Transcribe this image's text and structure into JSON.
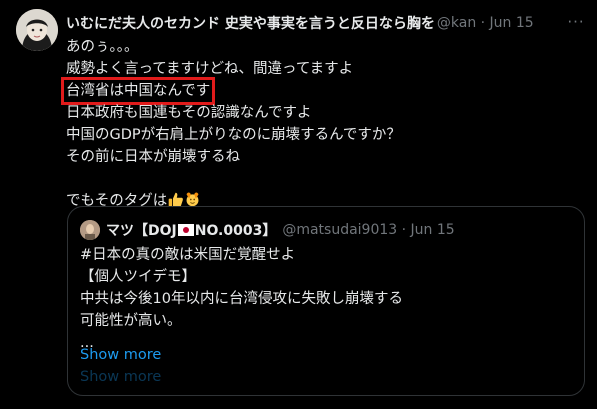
{
  "tweet": {
    "author_name": "いむにだ夫人のセカンド 史実や事実を言うと反日なら胸を",
    "handle_meta": "@kan · Jun 15",
    "more_label": "···",
    "lines": [
      "あのぅ。。。",
      "威勢よく言ってますけどね、間違ってますよ",
      "台湾省は中国なんです",
      "日本政府も国連もその認識なんですよ",
      "中国のGDPが右肩上がりなのに崩壊するんですか？",
      "その前に日本が崩壊するね",
      "",
      "でもそのタグは"
    ],
    "highlight_line_index": 2,
    "emoji_icons": [
      "thumbs-up-icon",
      "raising-hands-face-icon"
    ]
  },
  "quote": {
    "name_prefix": "マツ【DOJ",
    "name_suffix": "NO.0003】",
    "flag_icon": "japan-flag-icon",
    "handle_meta": "@matsudai9013 · Jun 15",
    "lines": [
      "#日本の真の敵は米国だ覚醒せよ",
      "【個人ツイデモ】",
      "中共は今後10年以内に台湾侵攻に失敗し崩壊する",
      "可能性が高い。",
      "..."
    ],
    "show_more": "Show more",
    "show_more_ghost": "Show more"
  },
  "colors": {
    "background": "#000000",
    "text": "#e7e9ea",
    "muted": "#71767b",
    "link": "#1d9bf0",
    "highlight_box": "#e11b1b",
    "border": "#2f3336"
  }
}
